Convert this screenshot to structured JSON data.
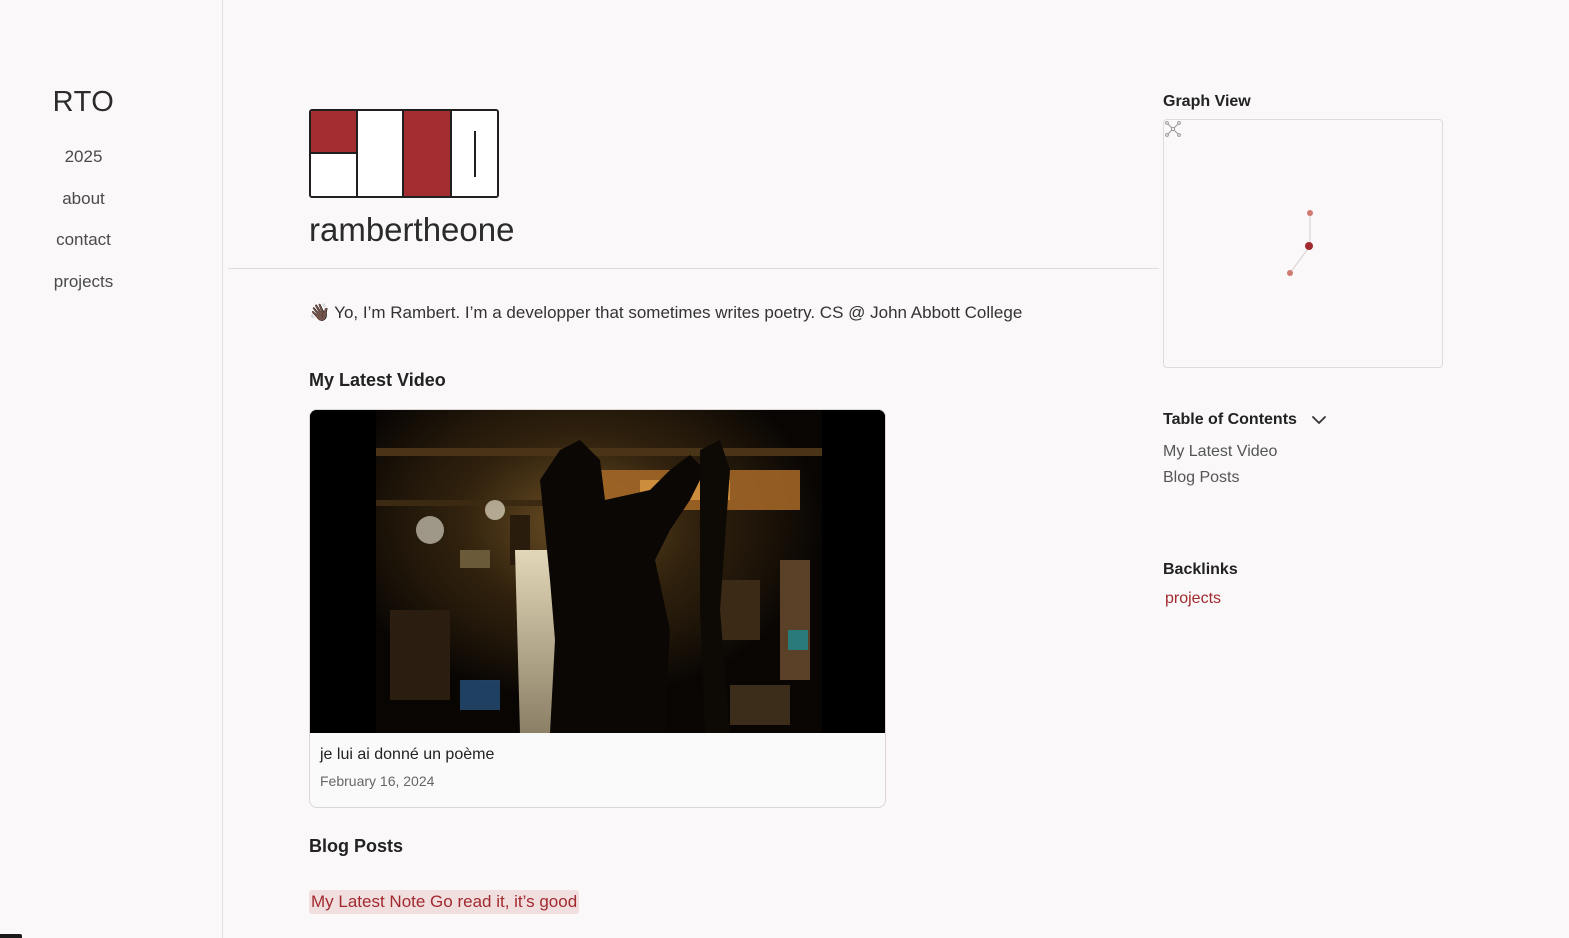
{
  "sidebar": {
    "site_title": "RTO",
    "nav": [
      {
        "label": "2025"
      },
      {
        "label": "about"
      },
      {
        "label": "contact"
      },
      {
        "label": "projects"
      }
    ]
  },
  "main": {
    "title": "rambertheone",
    "intro_emoji": "👋🏿",
    "intro_text": "Yo, I’m Rambert. I’m a developper that sometimes writes poetry. CS @ John Abbott College",
    "latest_video_heading": "My Latest Video",
    "video": {
      "title": "je lui ai donné un poème",
      "date": "February 16, 2024"
    },
    "blog_heading": "Blog Posts",
    "blog_link": "My Latest Note Go read it, it’s good"
  },
  "right": {
    "graph_heading": "Graph View",
    "graph_expand_icon": "expand-graph-icon",
    "toc_heading": "Table of Contents",
    "toc_items": [
      {
        "label": "My Latest Video"
      },
      {
        "label": "Blog Posts"
      }
    ],
    "backlinks_heading": "Backlinks",
    "backlinks": [
      {
        "label": "projects"
      }
    ]
  },
  "colors": {
    "accent": "#a12a2f",
    "logo_red": "#a42d32",
    "background": "#faf8f8"
  }
}
